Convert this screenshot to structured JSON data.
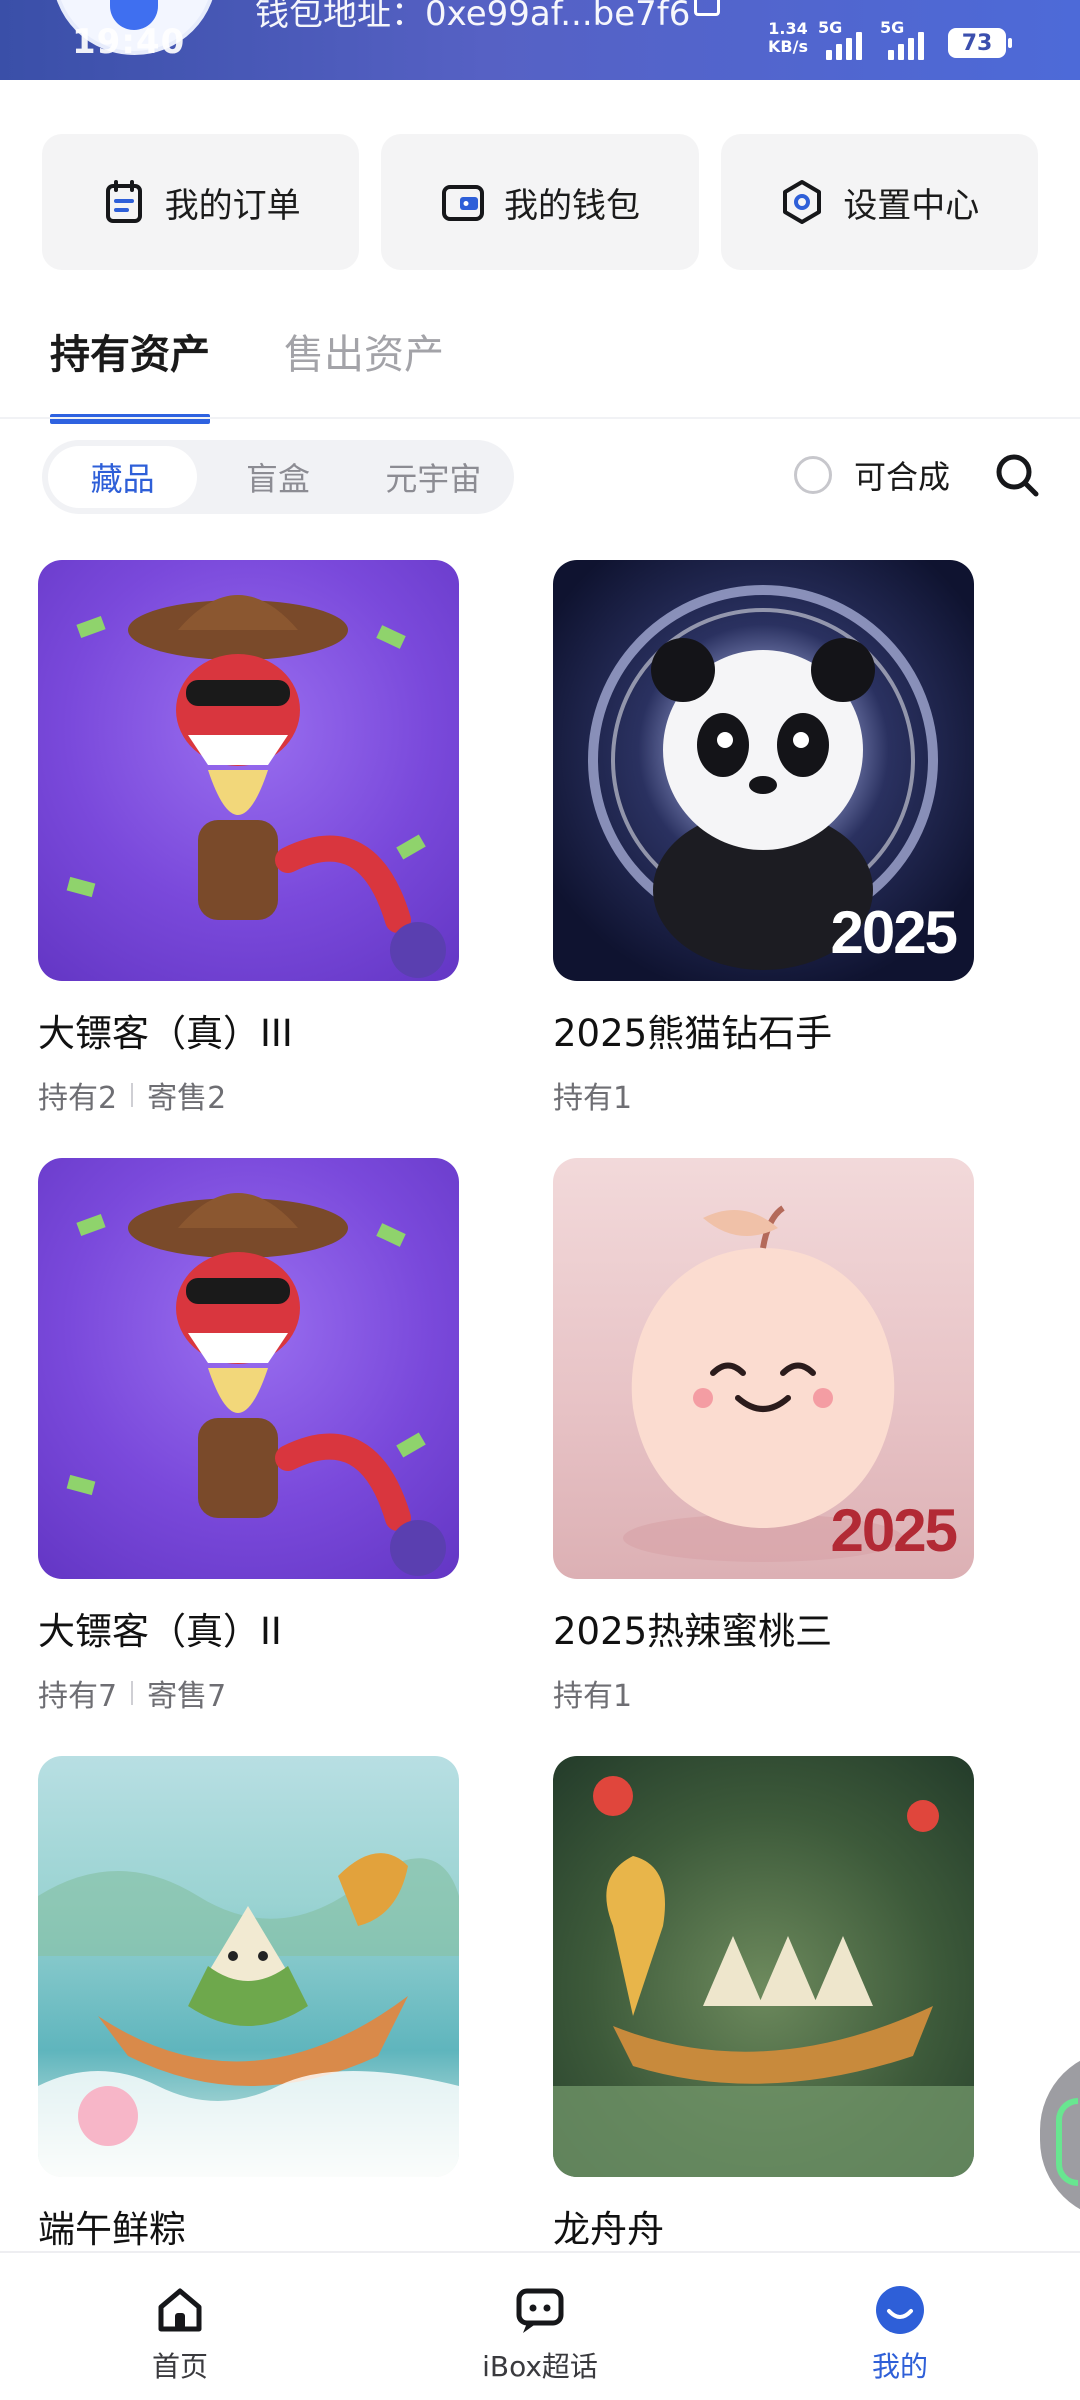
{
  "status_bar": {
    "time": "19:40",
    "wallet_label": "钱包地址：0xe99af...be7f6",
    "net_speed_top": "1.34",
    "net_speed_bottom": "KB/s",
    "signal_1": "5G",
    "signal_2": "5G",
    "battery": "73"
  },
  "quick_actions": [
    {
      "label": "我的订单",
      "icon": "order-icon"
    },
    {
      "label": "我的钱包",
      "icon": "wallet-icon"
    },
    {
      "label": "设置中心",
      "icon": "settings-icon"
    }
  ],
  "tabs": [
    {
      "label": "持有资产",
      "active": true
    },
    {
      "label": "售出资产",
      "active": false
    }
  ],
  "filter": {
    "segments": [
      {
        "label": "藏品",
        "active": true
      },
      {
        "label": "盲盒",
        "active": false
      },
      {
        "label": "元宇宙",
        "active": false
      }
    ],
    "synthesizable_label": "可合成",
    "synthesizable_checked": false
  },
  "assets": [
    {
      "title": "大镖客（真）III",
      "hold": "持有2",
      "sale": "寄售2",
      "image": "cowboy-snake"
    },
    {
      "title": "2025熊猫钻石手",
      "hold": "持有1",
      "sale": "",
      "image": "panda-2025",
      "badge": "2025",
      "badge_color": "#ffffff"
    },
    {
      "title": "大镖客（真）II",
      "hold": "持有7",
      "sale": "寄售7",
      "image": "cowboy-snake"
    },
    {
      "title": "2025热辣蜜桃三",
      "hold": "持有1",
      "sale": "",
      "image": "peach-2025",
      "badge": "2025",
      "badge_color": "#b22a35"
    },
    {
      "title": "端午鲜粽",
      "hold": "",
      "sale": "",
      "image": "zongzi-dragon-boat"
    },
    {
      "title": "龙舟舟",
      "hold": "",
      "sale": "",
      "image": "dragon-boat-race"
    }
  ],
  "bottom_nav": [
    {
      "label": "首页",
      "icon": "home-icon",
      "active": false
    },
    {
      "label": "iBox超话",
      "icon": "chat-icon",
      "active": false
    },
    {
      "label": "我的",
      "icon": "profile-icon",
      "active": true
    }
  ],
  "colors": {
    "accent": "#2e5fd8",
    "header_gradient_start": "#3a4fa8",
    "header_gradient_end": "#4d6ad8"
  }
}
